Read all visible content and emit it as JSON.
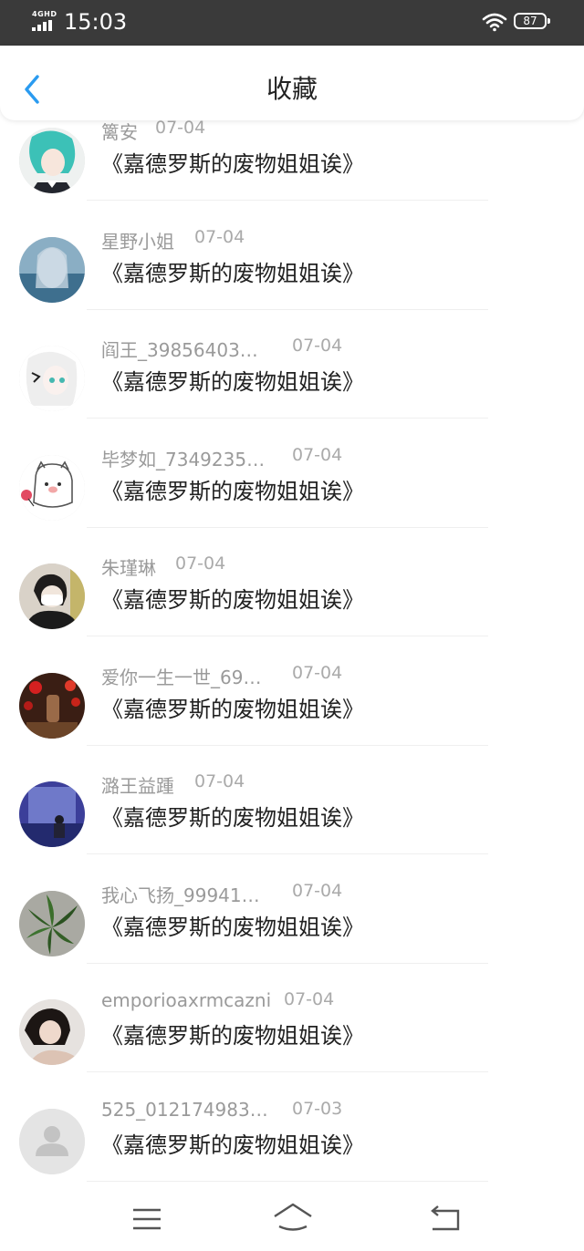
{
  "status_bar": {
    "network": "4GHD",
    "time": "15:03",
    "battery": "87"
  },
  "header": {
    "title": "收藏",
    "back_icon": "chevron-left-icon"
  },
  "favorites": [
    {
      "user": "篱安",
      "date": "07-04",
      "title": "《嘉德罗斯的废物姐姐诶》"
    },
    {
      "user": "星野小姐",
      "date": "07-04",
      "title": "《嘉德罗斯的废物姐姐诶》"
    },
    {
      "user": "阎王_39856403…",
      "date": "07-04",
      "title": "《嘉德罗斯的废物姐姐诶》"
    },
    {
      "user": "毕梦如_7349235…",
      "date": "07-04",
      "title": "《嘉德罗斯的废物姐姐诶》"
    },
    {
      "user": "朱瑾琳",
      "date": "07-04",
      "title": "《嘉德罗斯的废物姐姐诶》"
    },
    {
      "user": "爱你一生一世_69…",
      "date": "07-04",
      "title": "《嘉德罗斯的废物姐姐诶》"
    },
    {
      "user": "潞王益踵",
      "date": "07-04",
      "title": "《嘉德罗斯的废物姐姐诶》"
    },
    {
      "user": "我心飞扬_99941…",
      "date": "07-04",
      "title": "《嘉德罗斯的废物姐姐诶》"
    },
    {
      "user": "emporioaxrmcazni",
      "date": "07-04",
      "title": "《嘉德罗斯的废物姐姐诶》"
    },
    {
      "user": "525_012174983…",
      "date": "07-03",
      "title": "《嘉德罗斯的废物姐姐诶》"
    }
  ],
  "bottom_nav": {
    "icons": [
      "menu-icon",
      "home-icon",
      "back-icon"
    ]
  },
  "colors": {
    "accent": "#2a9bf0",
    "status_bar": "#3a3a3a",
    "muted_text": "#9a9a9a"
  }
}
